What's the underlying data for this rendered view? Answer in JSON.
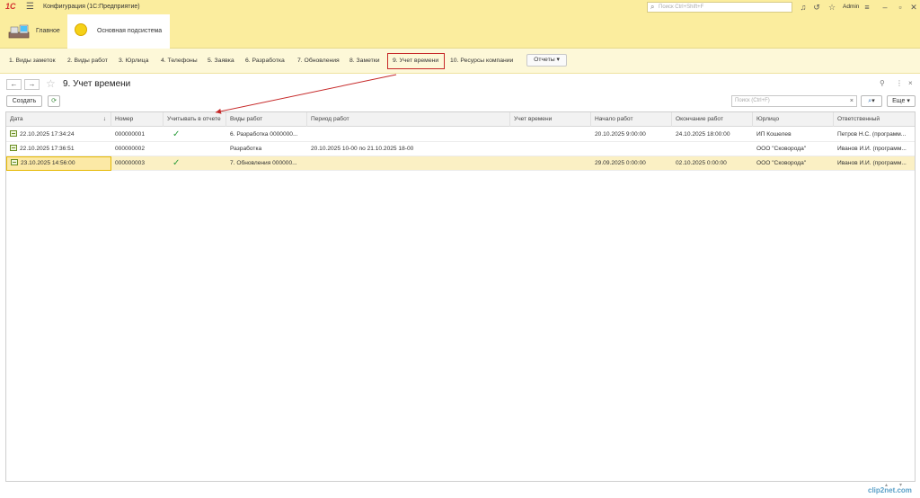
{
  "titlebar": {
    "logo": "1С",
    "title": "Конфигурация  (1С:Предприятие)",
    "search_placeholder": "Поиск Ctrl+Shift+F",
    "user": "Admin"
  },
  "sections": [
    {
      "label": "Главное"
    },
    {
      "label": "Основная подсистема"
    }
  ],
  "nav": {
    "items": [
      "1. Виды заметок",
      "2. Виды работ",
      "3. Юрлица",
      "4. Телефоны",
      "5. Заявка",
      "6. Разработка",
      "7. Обновления",
      "8. Заметки",
      "9. Учет времени",
      "10. Ресурсы компании"
    ],
    "reports_label": "Отчеты"
  },
  "form": {
    "title": "9. Учет времени",
    "create_label": "Создать",
    "search_placeholder": "Поиск (Ctrl+F)",
    "more_label": "Еще"
  },
  "table": {
    "headers": [
      "Дата",
      "Номер",
      "Учитывать в отчете",
      "Виды работ",
      "Период работ",
      "Учет времени",
      "Начало работ",
      "Окончание работ",
      "Юрлицо",
      "Ответственный"
    ],
    "rows": [
      {
        "date": "22.10.2025 17:34:24",
        "number": "000000001",
        "include": true,
        "work_type": "6. Разработка 0000000...",
        "period": "",
        "time": "",
        "start": "20.10.2025 9:00:00",
        "end": "24.10.2025 18:00:00",
        "entity": "ИП Кошелев",
        "responsible": "Петров Н.С. (программ..."
      },
      {
        "date": "22.10.2025 17:36:51",
        "number": "000000002",
        "include": false,
        "work_type": "Разработка",
        "period": "20.10.2025 10-00 по 21.10.2025 18-00",
        "time": "",
        "start": "",
        "end": "",
        "entity": "ООО \"Сковорода\"",
        "responsible": "Иванов И.И. (программ..."
      },
      {
        "date": "23.10.2025 14:56:00",
        "number": "000000003",
        "include": true,
        "work_type": "7. Обновления 000000...",
        "period": "",
        "time": "",
        "start": "29.09.2025 0:00:00",
        "end": "02.10.2025 0:00:00",
        "entity": "ООО \"Сковорода\"",
        "responsible": "Иванов И.И. (программ..."
      }
    ],
    "check_glyph": "✓"
  },
  "watermark": "clip2net.com",
  "colors": {
    "panel_yellow": "#fbed9e",
    "selected_row": "#fbf0c4",
    "annotation_red": "#c62828",
    "check_green": "#2e9e3e"
  }
}
